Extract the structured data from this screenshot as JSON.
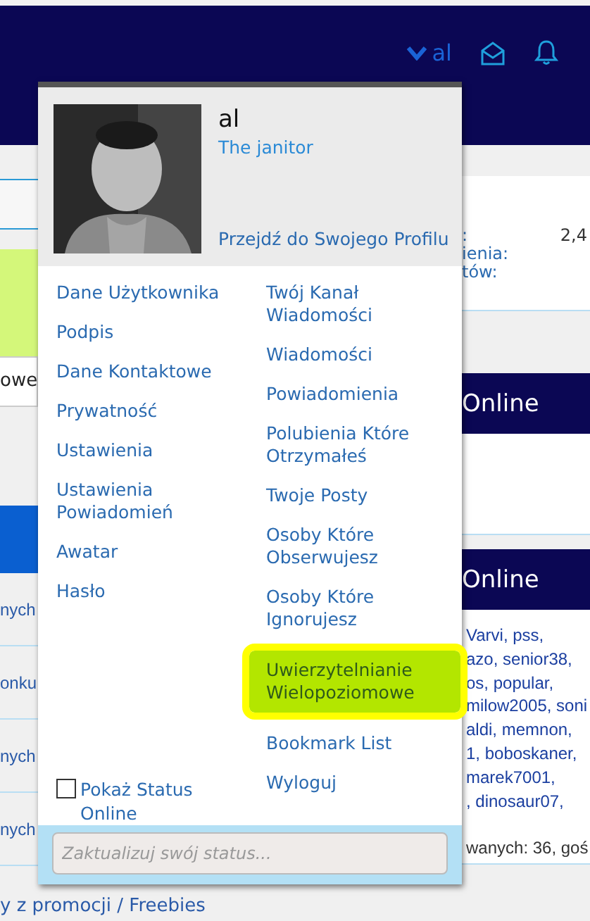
{
  "header": {
    "user": "al"
  },
  "page_left": {
    "field_value": "owe",
    "rows": [
      "nych",
      "onku",
      "nych",
      "nych",
      "y z promocji / Freebies"
    ]
  },
  "page_right": {
    "stats": [
      {
        "label": ":",
        "value": "2,4"
      },
      {
        "label": "ienia:"
      },
      {
        "label": "tów:"
      }
    ],
    "sections": [
      {
        "title": "Online"
      },
      {
        "title": "Online",
        "lines": [
          {
            "text": "Varvi, pss,",
            "kind": "link"
          },
          {
            "text": "azo, senior38,",
            "kind": "link"
          },
          {
            "text": "os, popular,",
            "kind": "link"
          },
          {
            "text": "milow2005, soni",
            "kind": "link"
          },
          {
            "text": "aldi, memnon,",
            "kind": "link"
          },
          {
            "text": "1, boboskaner,",
            "kind": "link"
          },
          {
            "text": "marek7001,",
            "kind": "link"
          },
          {
            "text": ", dinosaur07,",
            "kind": "link"
          },
          {
            "text": "wanych: 36, goś",
            "kind": "text"
          }
        ]
      }
    ]
  },
  "popup": {
    "name": "al",
    "rank": "The janitor",
    "profile_link": "Przejdź do Swojego Profilu",
    "left_items": [
      "Dane Użytkownika",
      "Podpis",
      "Dane Kontaktowe",
      "Prywatność",
      "Ustawienia",
      "Ustawienia Powiadomień",
      "Awatar",
      "Hasło"
    ],
    "right_items": [
      {
        "label": "Twój Kanał Wiadomości",
        "selected": false
      },
      {
        "label": "Wiadomości",
        "selected": false
      },
      {
        "label": "Powiadomienia",
        "selected": false
      },
      {
        "label": "Polubienia Które Otrzymałeś",
        "selected": false
      },
      {
        "label": "Twoje Posty",
        "selected": false
      },
      {
        "label": "Osoby Które Obserwujesz",
        "selected": false
      },
      {
        "label": "Osoby Które Ignorujesz",
        "selected": false
      },
      {
        "label": "Uwierzytelnianie Wielopoziomowe",
        "selected": true
      },
      {
        "label": "Bookmark List",
        "selected": false
      },
      {
        "label": "Wyloguj",
        "selected": false
      }
    ],
    "show_status": {
      "label": "Pokaż Status Online",
      "checked": false
    },
    "status_placeholder": "Zaktualizuj swój status..."
  }
}
